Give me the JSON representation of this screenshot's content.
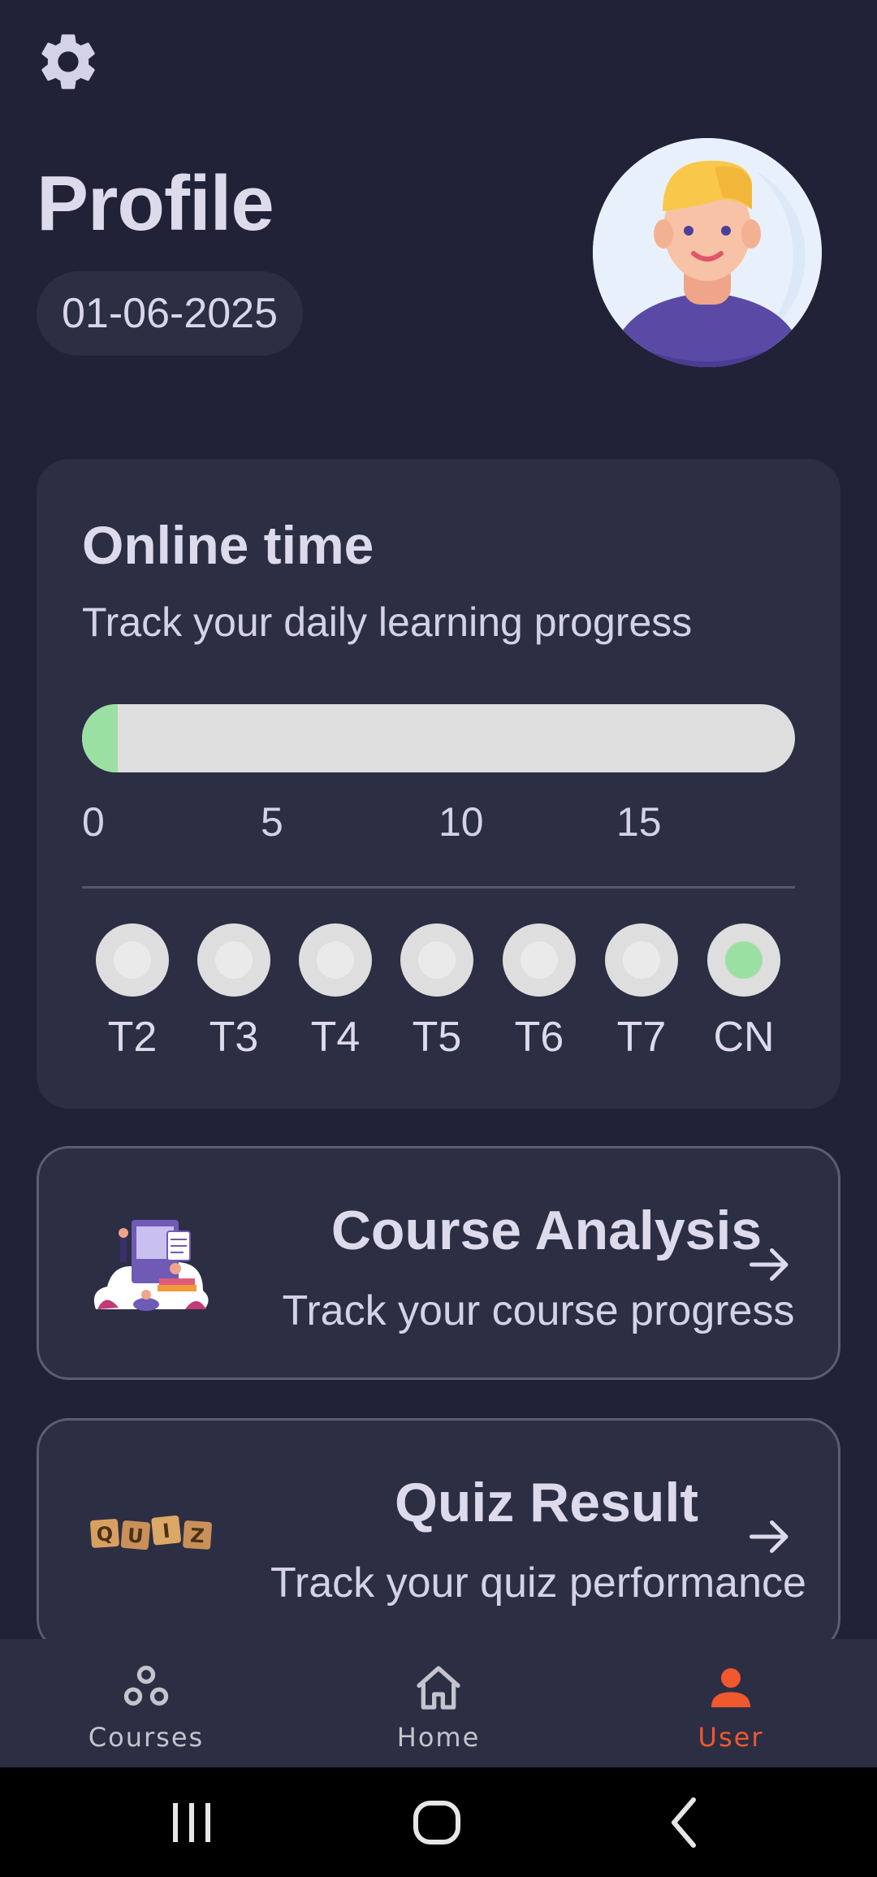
{
  "header": {
    "title": "Profile",
    "date": "01-06-2025"
  },
  "online_time": {
    "title": "Online time",
    "subtitle": "Track your daily learning progress",
    "progress_fraction": 0.05,
    "scale_ticks": [
      "0",
      "5",
      "10",
      "15"
    ],
    "days": [
      {
        "label": "T2",
        "active": false
      },
      {
        "label": "T3",
        "active": false
      },
      {
        "label": "T4",
        "active": false
      },
      {
        "label": "T5",
        "active": false
      },
      {
        "label": "T6",
        "active": false
      },
      {
        "label": "T7",
        "active": false
      },
      {
        "label": "CN",
        "active": true
      }
    ]
  },
  "course_analysis": {
    "title": "Course Analysis",
    "subtitle": "Track your course progress"
  },
  "quiz_result": {
    "title": "Quiz Result",
    "subtitle": "Track your quiz performance"
  },
  "bottom_nav": {
    "items": [
      {
        "label": "Courses",
        "icon": "courses-icon",
        "active": false
      },
      {
        "label": "Home",
        "icon": "home-icon",
        "active": false
      },
      {
        "label": "User",
        "icon": "user-icon",
        "active": true
      }
    ]
  },
  "colors": {
    "background": "#212237",
    "card": "#2c2e44",
    "accent_active": "#f0582d",
    "progress_fill": "#9be0a3",
    "progress_track": "#dedede"
  }
}
